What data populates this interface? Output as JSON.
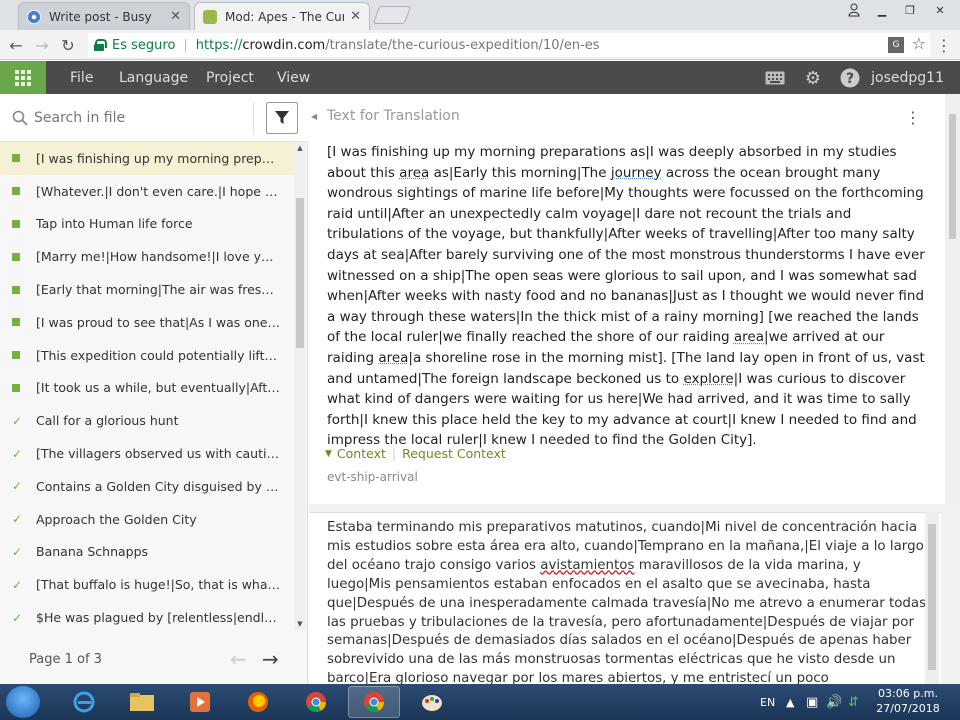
{
  "browser": {
    "tabs": [
      {
        "title": "Write post - Busy",
        "active": false
      },
      {
        "title": "Mod: Apes - The Curious",
        "active": true
      }
    ],
    "secure_label": "Es seguro",
    "url_scheme": "https://",
    "url_host": "crowdin.com",
    "url_path": "/translate/the-curious-expedition/10/en-es"
  },
  "app": {
    "menu": [
      "File",
      "Language",
      "Project",
      "View"
    ],
    "username": "josedpg11"
  },
  "left_panel": {
    "search_placeholder": "Search in file",
    "strings": [
      {
        "text": "[I was finishing up my morning preparations as|I was deeply absorbed",
        "status": "dot",
        "selected": true
      },
      {
        "text": "[Whatever.|I don't even care.|I hope you're happy now",
        "status": "dot"
      },
      {
        "text": "Tap into Human life force",
        "status": "dot"
      },
      {
        "text": "[Marry me!|How handsome!|I love you!|Be mine",
        "status": "dot"
      },
      {
        "text": "[Early that morning|The air was fresh and clear",
        "status": "dot"
      },
      {
        "text": "[I was proud to see that|As I was one of the first",
        "status": "dot"
      },
      {
        "text": "[This expedition could potentially lift me into",
        "status": "dot"
      },
      {
        "text": "[It took us a while, but eventually|After a long time",
        "status": "dot"
      },
      {
        "text": "Call for a glorious hunt",
        "status": "check"
      },
      {
        "text": "[The villagers observed us with caution as we approached",
        "status": "check"
      },
      {
        "text": "Contains a Golden City disguised by a shrine",
        "status": "check"
      },
      {
        "text": "Approach the Golden City",
        "status": "check"
      },
      {
        "text": "Banana Schnapps",
        "status": "check"
      },
      {
        "text": "[That buffalo is huge!|So, that is what a buffalo looks like",
        "status": "check"
      },
      {
        "text": "$He was plagued by [relentless|endless] nightmares",
        "status": "check"
      }
    ],
    "page_label": "Page 1 of 3"
  },
  "source": {
    "header": "Text for Translation",
    "segments": [
      {
        "t": "[I was finishing up my morning preparations as|I was deeply absorbed in my studies about this "
      },
      {
        "t": "area",
        "u": true
      },
      {
        "t": " as|Early this morning|The "
      },
      {
        "t": "journey",
        "u": true
      },
      {
        "t": " across the ocean brought many wondrous sightings of marine life before|My thoughts were focussed on the forthcoming raid until|After an unexpectedly calm voyage|I dare not recount the trials and tribulations of the voyage, but thankfully|After weeks of travelling|After too many salty days at sea|After barely surviving one of the most monstrous thunderstorms I have ever witnessed on a ship|The open seas were glorious to sail upon, and I was somewhat sad when|After weeks with nasty food and no bananas|Just as I thought we would never find a way through these waters|In the thick mist of a rainy morning] [we reached the lands of the local ruler|we finally reached the shore of our raiding "
      },
      {
        "t": "area",
        "u": true
      },
      {
        "t": "|we arrived at our raiding "
      },
      {
        "t": "area",
        "u": true
      },
      {
        "t": "|a shoreline rose in the morning mist]. [The land lay open in front of us, vast and untamed|The foreign landscape beckoned us to "
      },
      {
        "t": "explore",
        "u": true
      },
      {
        "t": "|I was curious to discover what kind of dangers were waiting for us here|We had arrived, and it was time to sally forth|I knew this place held the key to my advance at court|I knew I needed to find and impress the local ruler|I knew I needed to find the Golden City]."
      }
    ],
    "context_label": "Context",
    "request_context_label": "Request Context",
    "string_key": "evt-ship-arrival"
  },
  "translation": {
    "before_spell": "Estaba terminando mis preparativos matutinos, cuando|Mi nivel de concentración hacia mis estudios sobre esta área era alto, cuando|Temprano en la mañana,|El viaje a lo largo del océano trajo consigo varios ",
    "spell_word": "avistamientos",
    "after_spell": " maravillosos de la vida marina, y luego|Mis pensamientos estaban enfocados en el asalto que se avecinaba, hasta que|Después de una inesperadamente calmada travesía|No me atrevo a enumerar todas las pruebas y tribulaciones de la travesía, pero afortunadamente|Después de viajar por semanas|Después de demasiados días salados en el océano|Después de apenas haber sobrevivido una de las más monstruosas tormentas eléctricas que he visto desde un barco|Era glorioso navegar por los mares abiertos, y me entristecí un poco cuando|Después de semanas de pura comida"
  },
  "taskbar": {
    "lang": "EN",
    "time": "03:06 p.m.",
    "date": "27/07/2018"
  },
  "colors": {
    "accent_green": "#76b041",
    "header_bg": "#4b4b4b",
    "grid_button": "#6aa64a"
  }
}
